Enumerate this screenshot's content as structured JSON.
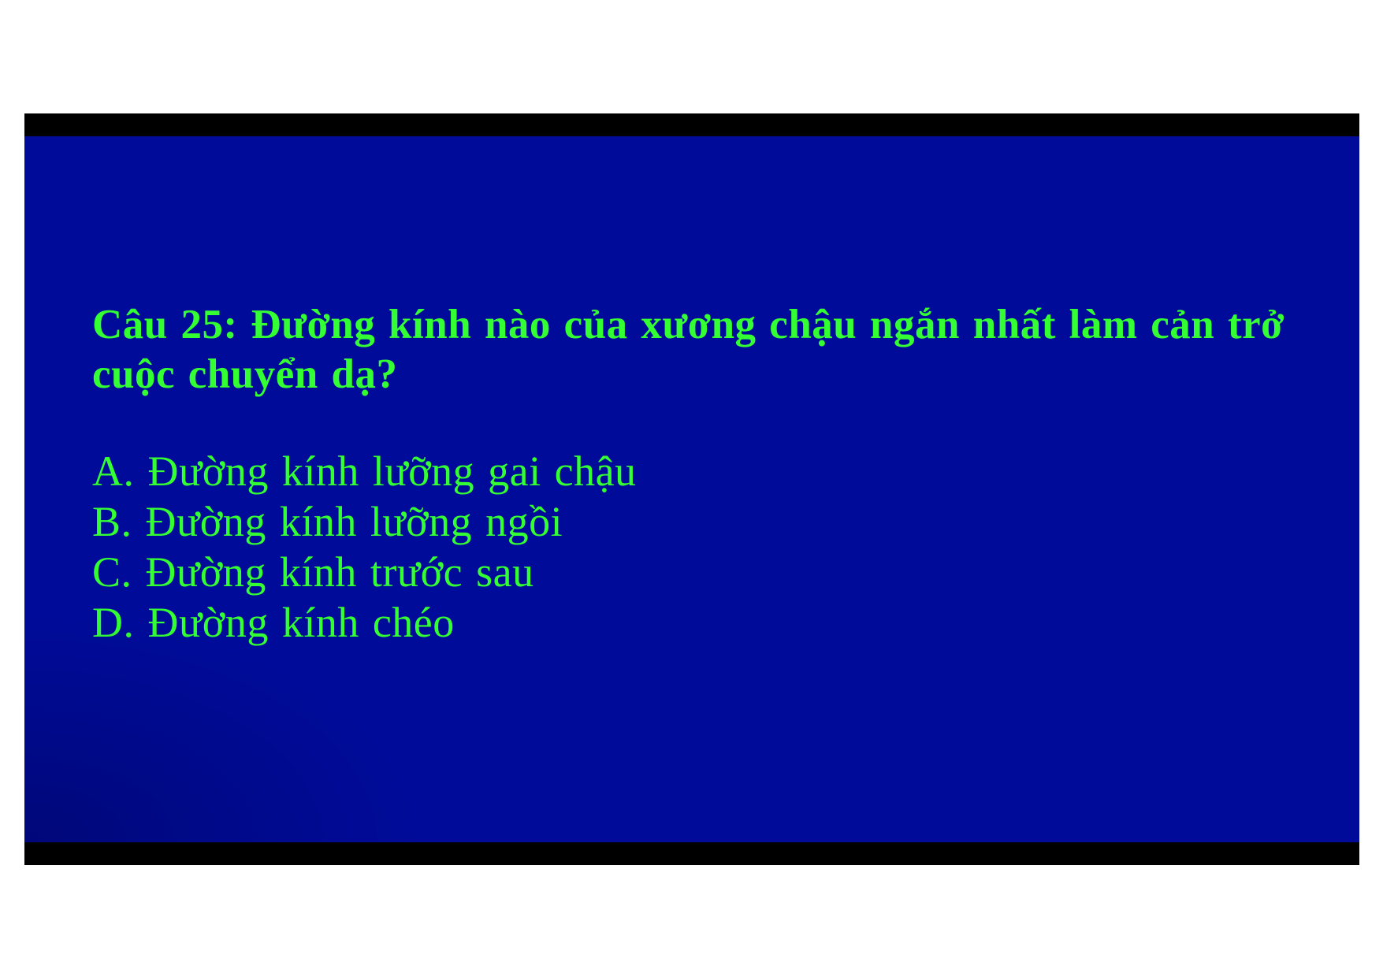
{
  "slide": {
    "question": "Câu 25: Đường kính nào của xương chậu ngắn nhất làm cản trở cuộc chuyển dạ?",
    "answers": [
      "A. Đường kính lưỡng gai chậu",
      "B. Đường kính lưỡng ngồi",
      "C. Đường kính trước sau",
      "D. Đường kính chéo"
    ],
    "colors": {
      "background": "#000b9a",
      "text": "#33ff33",
      "frame": "#000000"
    }
  }
}
